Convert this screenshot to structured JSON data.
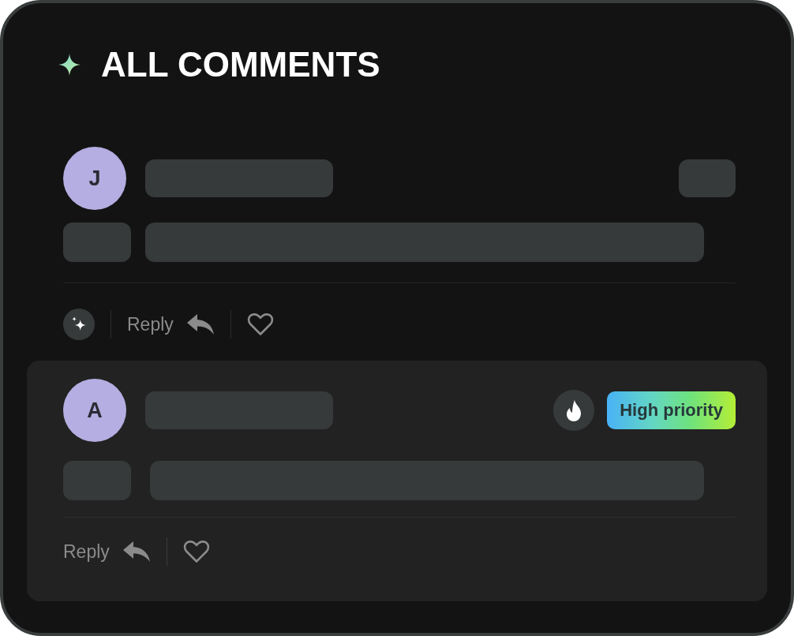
{
  "header": {
    "title": "ALL COMMENTS"
  },
  "comments": [
    {
      "avatar": "J",
      "highlighted": false,
      "actions": [
        {
          "kind": "ai"
        },
        {
          "kind": "reply",
          "label": "Reply"
        },
        {
          "kind": "like",
          "liked": false
        }
      ]
    },
    {
      "avatar": "A",
      "highlighted": true,
      "priority": {
        "label": "High priority"
      },
      "actions": [
        {
          "kind": "reply",
          "label": "Reply"
        },
        {
          "kind": "like",
          "liked": false
        }
      ]
    }
  ]
}
